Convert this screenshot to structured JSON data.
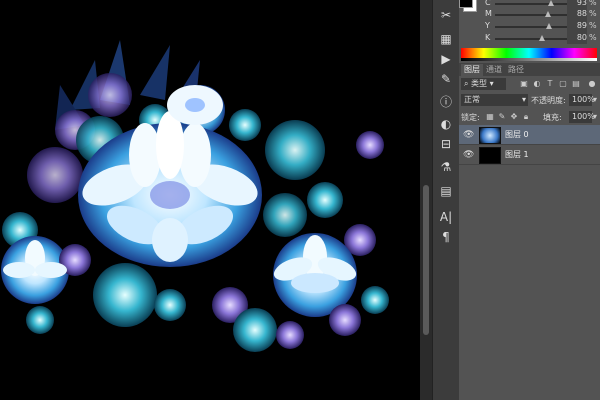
{
  "app": {
    "name": "Photoshop"
  },
  "colors": {
    "panel_bg": "#535353",
    "toolbar_bg": "#3c3c3c",
    "selected_layer": "#5d6878"
  },
  "color_panel": {
    "sliders": [
      {
        "label": "C",
        "value": "93",
        "unit": "%",
        "level": 0.93
      },
      {
        "label": "M",
        "value": "88",
        "unit": "%",
        "level": 0.88
      },
      {
        "label": "Y",
        "value": "89",
        "unit": "%",
        "level": 0.89
      },
      {
        "label": "K",
        "value": "80",
        "unit": "%",
        "level": 0.8
      }
    ]
  },
  "layers_panel": {
    "tabs": [
      "图层",
      "通道",
      "路径"
    ],
    "active_tab": 0,
    "filter_label": "类型",
    "blend_mode": "正常",
    "opacity_label": "不透明度:",
    "opacity_value": "100%",
    "lock_label": "锁定:",
    "fill_label": "填充:",
    "fill_value": "100%",
    "layers": [
      {
        "name": "图层 0",
        "selected": true,
        "visible": true
      },
      {
        "name": "图层 1",
        "selected": false,
        "visible": true
      }
    ]
  }
}
